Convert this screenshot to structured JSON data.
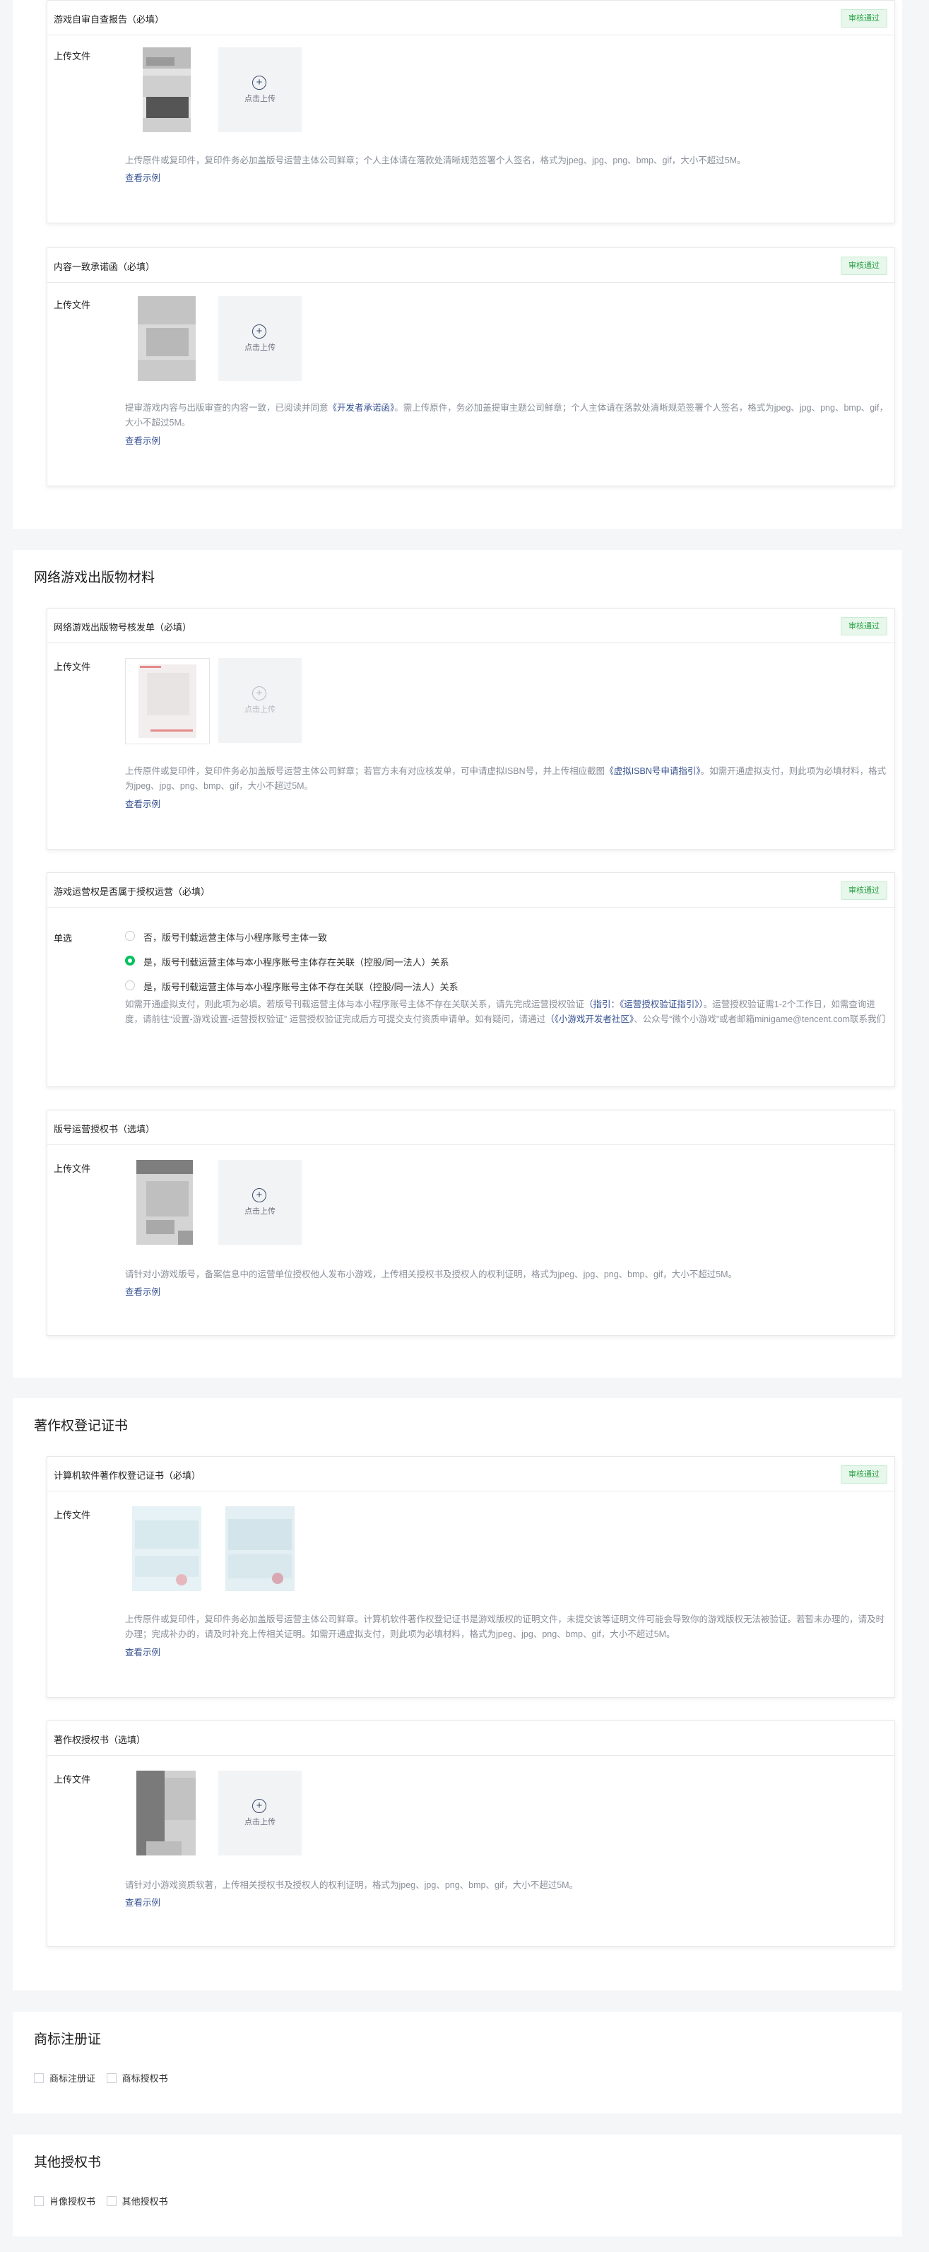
{
  "badge_approved": "审核通过",
  "upload_label": "上传文件",
  "upload_button": "点击上传",
  "example_link": "查看示例",
  "sec1": {
    "card1": {
      "title": "游戏自审自查报告（必填）",
      "desc": "上传原件或复印件，复印件务必加盖版号运营主体公司鲜章；个人主体请在落款处清晰规范签署个人签名，格式为jpeg、jpg、png、bmp、gif，大小不超过5M。"
    },
    "card2": {
      "title": "内容一致承诺函（必填）",
      "desc_a": "提审游戏内容与出版审查的内容一致，已阅读并同意",
      "desc_link": "《开发者承诺函》",
      "desc_b": "。需上传原件，务必加盖提审主题公司鲜章；个人主体请在落款处清晰规范签署个人签名，格式为jpeg、jpg、png、bmp、gif，大小不超过5M。"
    }
  },
  "sec2": {
    "title": "网络游戏出版物材料",
    "card1": {
      "title": "网络游戏出版物号核发单（必填）",
      "desc_a": "上传原件或复印件，复印件务必加盖版号运营主体公司鲜章；若官方未有对应核发单，可申请虚拟ISBN号，并上传相应截图",
      "desc_link": "《虚拟ISBN号申请指引》",
      "desc_b": "。如需开通虚拟支付，则此项为必填材料，格式为jpeg、jpg、png、bmp、gif，大小不超过5M。"
    },
    "card2": {
      "title": "游戏运营权是否属于授权运营（必填）",
      "label": "单选",
      "options": [
        "否，版号刊载运营主体与小程序账号主体一致",
        "是，版号刊载运营主体与本小程序账号主体存在关联（控股/同一法人）关系",
        "是，版号刊载运营主体与本小程序账号主体不存在关联（控股/同一法人）关系"
      ],
      "selected_index": 1,
      "desc_a": "如需开通虚拟支付，则此项为必填。若版号刊载运营主体与本小程序账号主体不存在关联关系，请先完成运营授权验证",
      "desc_link1": "（指引：《运营授权验证指引》）",
      "desc_b": "。运营授权验证需1-2个工作日，如需查询进度，请前往“设置-游戏设置-运营授权验证” 运营授权验证完成后方可提交支付资质申请单。如有疑问，请通过",
      "desc_link2": "（《小游戏开发者社区》",
      "desc_c": "、公众号“微个小游戏”或者邮箱minigame@tencent.com联系我们"
    },
    "card3": {
      "title": "版号运营授权书（选填）",
      "desc": "请针对小游戏版号，备案信息中的运营单位授权他人发布小游戏，上传相关授权书及授权人的权利证明，格式为jpeg、jpg、png、bmp、gif，大小不超过5M。"
    }
  },
  "sec3": {
    "title": "著作权登记证书",
    "card1": {
      "title": "计算机软件著作权登记证书（必填）",
      "desc": "上传原件或复印件，复印件务必加盖版号运营主体公司鲜章。计算机软件著作权登记证书是游戏版权的证明文件，未提交该等证明文件可能会导致你的游戏版权无法被验证。若暂未办理的，请及时办理；完成补办的，请及时补充上传相关证明。如需开通虚拟支付，则此项为必填材料，格式为jpeg、jpg、png、bmp、gif，大小不超过5M。"
    },
    "card2": {
      "title": "著作权授权书（选填）",
      "desc": "请针对小游戏资质软著，上传相关授权书及授权人的权利证明，格式为jpeg、jpg、png、bmp、gif，大小不超过5M。"
    }
  },
  "sec4": {
    "title": "商标注册证",
    "options": [
      "商标注册证",
      "商标授权书"
    ]
  },
  "sec5": {
    "title": "其他授权书",
    "options": [
      "肖像授权书",
      "其他授权书"
    ]
  }
}
